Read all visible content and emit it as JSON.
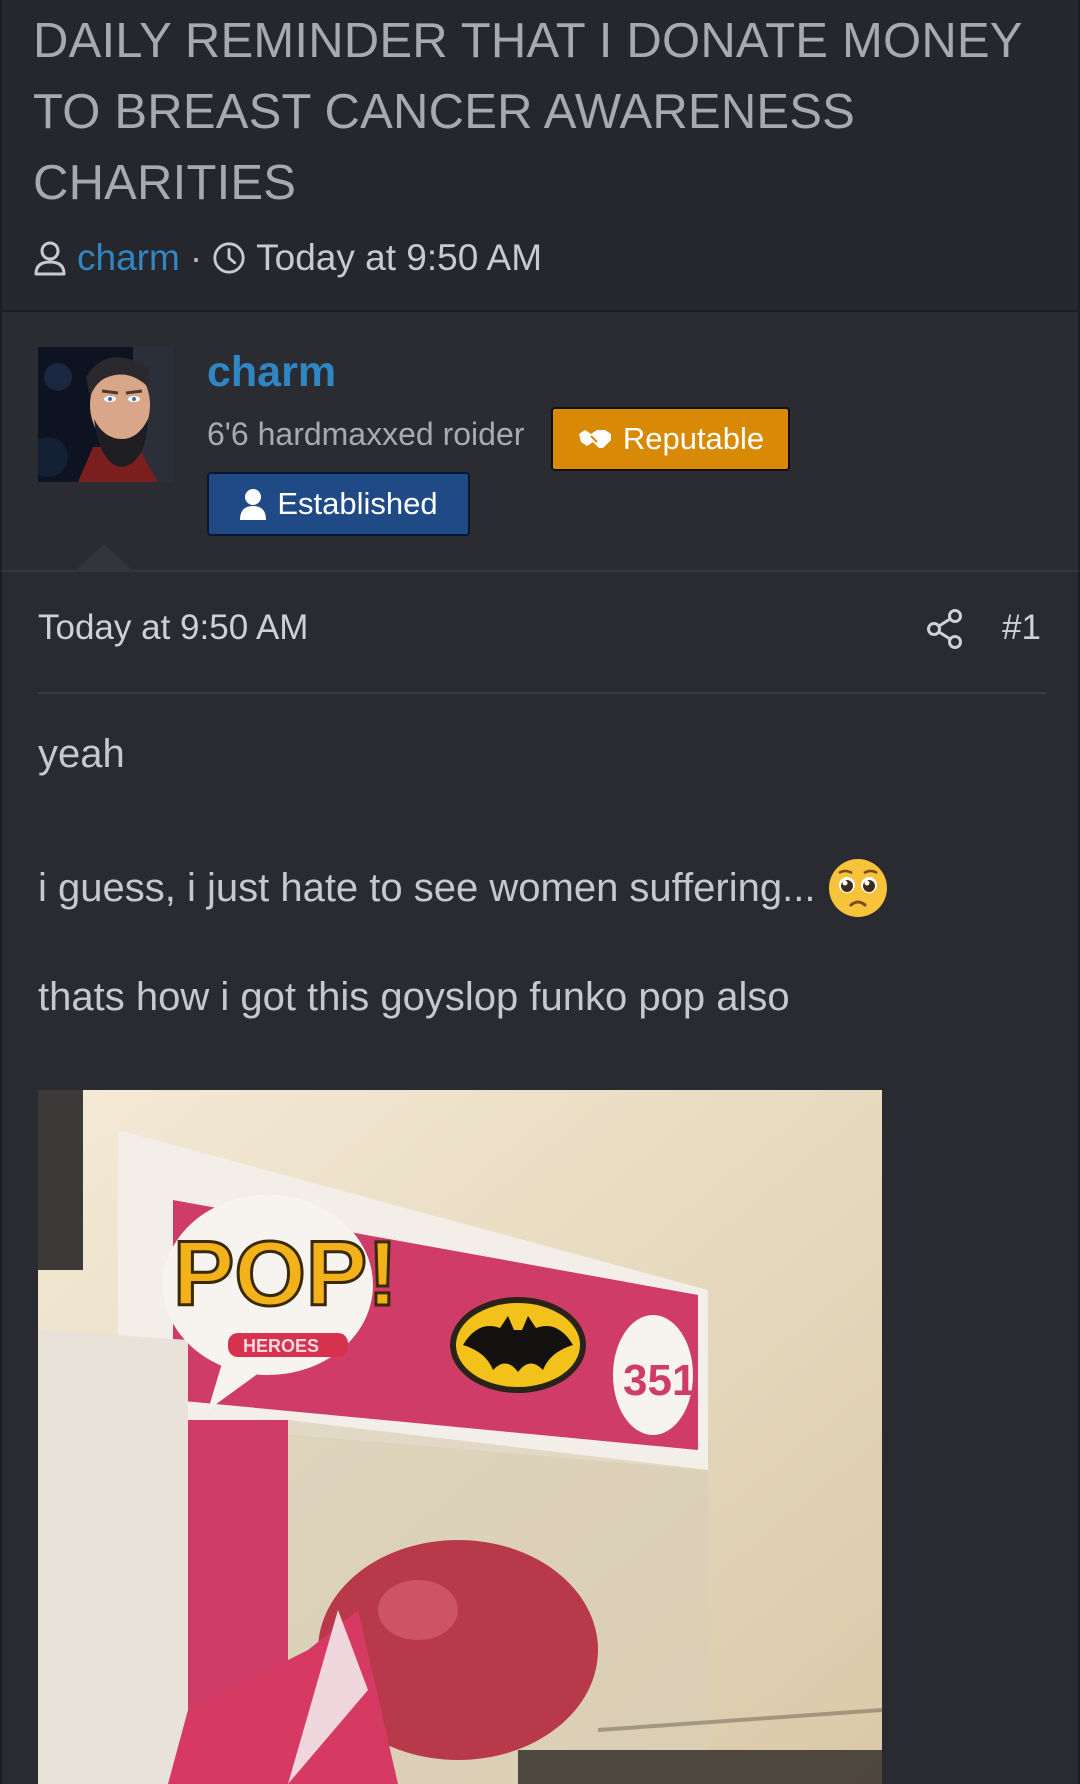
{
  "thread": {
    "title": "DAILY REMINDER THAT I DONATE MONEY TO BREAST CANCER AWARENESS CHARITIES",
    "author": "charm",
    "separator": "·",
    "date": "Today at 9:50 AM"
  },
  "user": {
    "name": "charm",
    "title": "6'6 hardmaxxed roider",
    "badges": [
      {
        "label": "Reputable",
        "icon": "handshake-icon",
        "color": "#d88a06"
      },
      {
        "label": "Established",
        "icon": "user-icon",
        "color": "#1f4a86"
      }
    ]
  },
  "post": {
    "date": "Today at 9:50 AM",
    "number": "#1",
    "share_icon": "share-icon",
    "lines": [
      "yeah",
      "i guess, i just hate to see women suffering...",
      "thats how i got this goyslop funko pop also"
    ],
    "emoji": "pleading-face-emoji",
    "attachment": {
      "pop_logo": "POP!",
      "pop_sub": "HEROES",
      "number": "351"
    }
  },
  "colors": {
    "accent": "#2f86c2",
    "background": "#27282d"
  }
}
